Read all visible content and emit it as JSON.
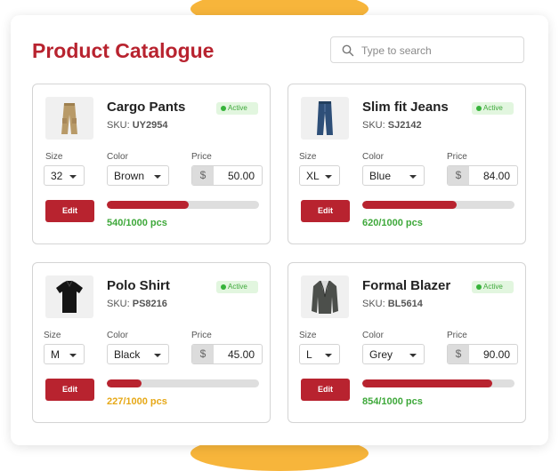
{
  "page": {
    "title": "Product Catalogue"
  },
  "search": {
    "placeholder": "Type to search"
  },
  "labels": {
    "size": "Size",
    "color": "Color",
    "price": "Price",
    "edit": "Edit",
    "currency": "$"
  },
  "colors": {
    "accent": "#b8232f",
    "decor": "#f7b53b",
    "active_badge": "#3ea83a",
    "stock_ok": "#3ea83a",
    "stock_low": "#e6a817"
  },
  "products": [
    {
      "name": "Cargo Pants",
      "sku_label": "SKU: ",
      "sku": "UY2954",
      "status": "Active",
      "size": "32",
      "color": "Brown",
      "price": "50.00",
      "stock_text": "540/1000 pcs",
      "stock_fraction": 0.54,
      "stock_color": "#3ea83a",
      "icon": "cargo-pants-image"
    },
    {
      "name": "Slim fit Jeans",
      "sku_label": "SKU: ",
      "sku": "SJ2142",
      "status": "Active",
      "size": "XL",
      "color": "Blue",
      "price": "84.00",
      "stock_text": "620/1000 pcs",
      "stock_fraction": 0.62,
      "stock_color": "#3ea83a",
      "icon": "jeans-image"
    },
    {
      "name": "Polo Shirt",
      "sku_label": "SKU: ",
      "sku": "PS8216",
      "status": "Active",
      "size": "M",
      "color": "Black",
      "price": "45.00",
      "stock_text": "227/1000 pcs",
      "stock_fraction": 0.227,
      "stock_color": "#e6a817",
      "icon": "polo-shirt-image"
    },
    {
      "name": "Formal Blazer",
      "sku_label": "SKU: ",
      "sku": "BL5614",
      "status": "Active",
      "size": "L",
      "color": "Grey",
      "price": "90.00",
      "stock_text": "854/1000 pcs",
      "stock_fraction": 0.854,
      "stock_color": "#3ea83a",
      "icon": "blazer-image"
    }
  ]
}
